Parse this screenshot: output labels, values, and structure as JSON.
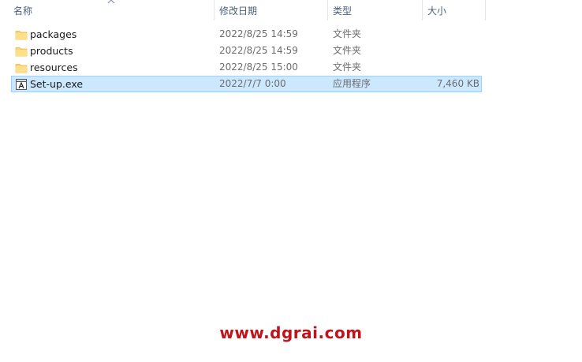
{
  "columns": {
    "name": "名称",
    "date": "修改日期",
    "type": "类型",
    "size": "大小"
  },
  "files": [
    {
      "name": "packages",
      "date": "2022/8/25 14:59",
      "type": "文件夹",
      "size": "",
      "icon": "folder-icon"
    },
    {
      "name": "products",
      "date": "2022/8/25 14:59",
      "type": "文件夹",
      "size": "",
      "icon": "folder-icon"
    },
    {
      "name": "resources",
      "date": "2022/8/25 15:00",
      "type": "文件夹",
      "size": "",
      "icon": "folder-icon"
    },
    {
      "name": "Set-up.exe",
      "date": "2022/7/7 0:00",
      "type": "应用程序",
      "size": "7,460 KB",
      "icon": "application-icon",
      "selected": true
    }
  ],
  "watermark": "www.dgrai.com",
  "colors": {
    "selection_bg": "#cce8ff",
    "selection_border": "#99d1ff",
    "folder": "#f8d775",
    "watermark": "#c0141c"
  }
}
